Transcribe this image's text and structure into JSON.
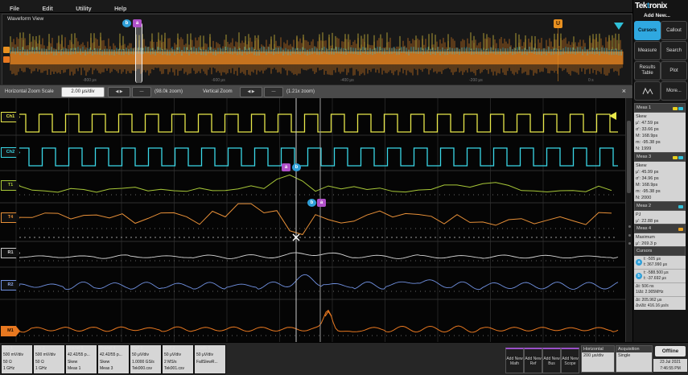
{
  "menu": {
    "items": [
      "File",
      "Edit",
      "Utility",
      "Help"
    ]
  },
  "overview": {
    "title": "Waveform View",
    "time_labels": [
      "-800 μs",
      "-600 μs",
      "-400 μs",
      "-200 μs",
      "0 s"
    ],
    "trigger_label": "U",
    "cursor_a": "a",
    "cursor_b": "b"
  },
  "zoombar": {
    "h_label": "Horizontal Zoom Scale",
    "h_scale": "2.00 μs/div",
    "h_zoom": "(98.0k zoom)",
    "v_label": "Vertical Zoom",
    "v_zoom": "(1.21x zoom)",
    "btn_arrows": "◀ ▶",
    "btn_minus": "—",
    "close": "×"
  },
  "sidebar": {
    "logo_left": "Tek",
    "logo_accent": "t",
    "logo_right": "ronix",
    "add_new": "Add New...",
    "buttons": [
      "Cursors",
      "Callout",
      "Measure",
      "Search",
      "Results Table",
      "Plot",
      "More..."
    ],
    "meas": [
      {
        "title": "Meas 1",
        "lines": [
          "Skew",
          "μ': 47.59 ps",
          "σ': 33.66 ps",
          "M: 168.9ps",
          "m: -95.38 ps",
          "N: 1999"
        ]
      },
      {
        "title": "Meas 3",
        "lines": [
          "Skew",
          "μ': 45.99 ps",
          "σ': 34.96 ps",
          "M: 168.9ps",
          "m: -95.38 ps",
          "N: 2000"
        ]
      },
      {
        "title": "Meas 2",
        "lines": [
          "PJ",
          "μ': 22.88 ps"
        ]
      },
      {
        "title": "Meas 4",
        "lines": [
          "Maximum",
          "μ': 269.3 p"
        ]
      }
    ],
    "cursors_panel": {
      "title": "Cursors",
      "rows": [
        {
          "icon": "a",
          "l1": "t: -505 μs",
          "l2": "t: 367.990 μs"
        },
        {
          "icon": "b",
          "l1": "t: -588.500 μs",
          "l2": "t: -37.692 μs"
        },
        {
          "icon": "",
          "l1": "Δt: 506 ns",
          "l2": "1/Δt: 2.905MHz"
        },
        {
          "icon": "",
          "l1": "Δt: 205.962 μs",
          "l2": "Δv/Δt: 416.16 μs/s"
        }
      ]
    }
  },
  "channels": [
    {
      "badge": "Ch 1",
      "handle": "Ch1",
      "color": "#e8e84a",
      "head_bg": "#4a4a14",
      "head_fg": "#e8e84a",
      "lines": [
        "500 mV/div",
        "50 Ω",
        "1 GHz"
      ]
    },
    {
      "badge": "Ch 2",
      "handle": "Ch2",
      "color": "#3ad8e8",
      "head_bg": "#0e4a52",
      "head_fg": "#3ad8e8",
      "lines": [
        "500 mV/div",
        "50 Ω",
        "1 GHz"
      ]
    },
    {
      "badge": "Trend 1",
      "handle": "T1",
      "color": "#a8c838",
      "head_bg": "#37400e",
      "head_fg": "#c8d860",
      "lines": [
        "42.42/55 p...",
        "Skew",
        "Meas 1"
      ]
    },
    {
      "badge": "Trend 4",
      "handle": "T4",
      "color": "#e89038",
      "head_bg": "#46280c",
      "head_fg": "#e89038",
      "lines": [
        "42.42/55 p...",
        "Skew",
        "Meas 3"
      ]
    },
    {
      "badge": "Ref 1",
      "handle": "R1",
      "color": "#d8d8d8",
      "head_bg": "#5a5a5a",
      "head_fg": "#eeeeee",
      "lines": [
        "50 μV/div",
        "1.0000 GS/s",
        "Tek000.csv"
      ]
    },
    {
      "badge": "Ref 2",
      "handle": "R2",
      "color": "#7090e0",
      "head_bg": "#5a5a5a",
      "head_fg": "#eeeeee",
      "lines": [
        "50 μV/div",
        "2 MS/s",
        "Tek001.csv"
      ]
    },
    {
      "badge": "Math 1",
      "handle": "M1",
      "color": "#e87820",
      "head_bg": "#e87820",
      "head_fg": "#1a0d00",
      "lines": [
        "50 μV/div",
        "FallSlewR...",
        ""
      ]
    }
  ],
  "bottom": {
    "add_buttons": [
      "Add New Math",
      "Add New Ref",
      "Add New Bus",
      "Add New Scope"
    ],
    "horizontal": {
      "title": "Horizontal",
      "value": "200 μs/div"
    },
    "acquisition": {
      "title": "Acquisition",
      "value": "Single"
    },
    "offline": "Offline",
    "date": "23 Jul 2021",
    "time": "7:46:55 PM"
  },
  "colors": {
    "noise_main": "#e08020",
    "noise_band": "#30c0d8",
    "noise_spike": "#e8d040",
    "cursor_line": "#cccccc",
    "accent_active": "#2fa8e0"
  }
}
